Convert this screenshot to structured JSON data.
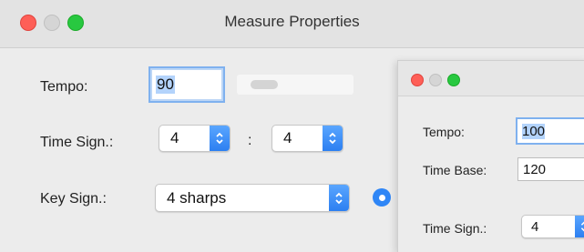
{
  "window": {
    "title": "Measure Properties"
  },
  "colors": {
    "close": "#fe5f57",
    "minimize": "#d5d5d5",
    "zoom": "#28c840",
    "accent": "#2f86f6"
  },
  "tempo": {
    "label": "Tempo:",
    "value": "90",
    "slider_position": 0.15
  },
  "time_sign": {
    "label": "Time Sign.:",
    "numerator": "4",
    "separator": ":",
    "denominator": "4"
  },
  "key_sign": {
    "label": "Key Sign.:",
    "value": "4 sharps"
  },
  "secondary": {
    "tempo_label": "Tempo:",
    "tempo_value": "100",
    "time_base_label": "Time Base:",
    "time_base_value": "120",
    "time_sign_label": "Time Sign.:",
    "time_sign_value": "4"
  }
}
